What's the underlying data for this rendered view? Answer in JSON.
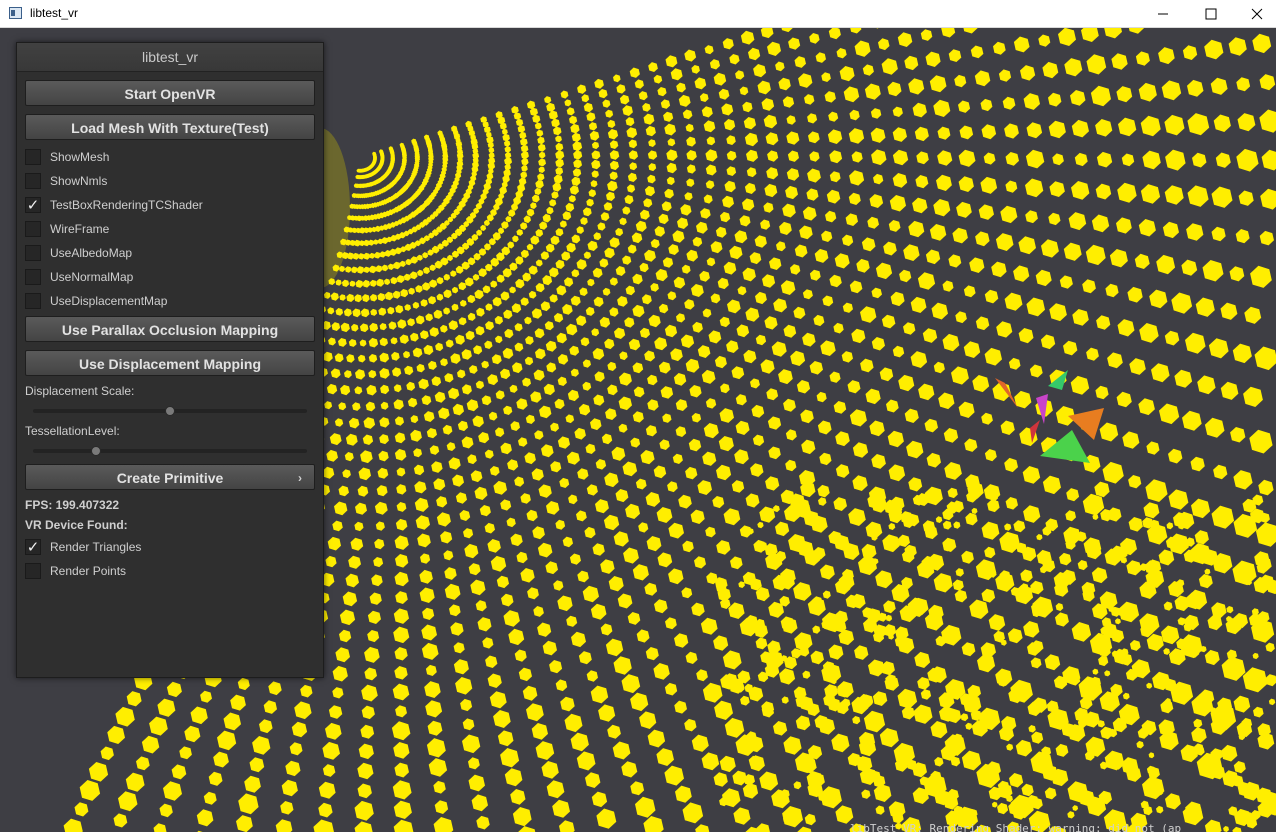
{
  "window": {
    "title": "libtest_vr",
    "minimize_label": "Minimize",
    "maximize_label": "Maximize",
    "close_label": "Close"
  },
  "panel": {
    "title": "libtest_vr",
    "buttons": {
      "start_openvr": "Start OpenVR",
      "load_mesh": "Load Mesh With Texture(Test)",
      "parallax": "Use Parallax Occlusion Mapping",
      "displacement": "Use Displacement Mapping",
      "create_primitive": "Create Primitive"
    },
    "create_primitive_arrow": "›",
    "checkboxes": [
      {
        "label": "ShowMesh",
        "checked": false
      },
      {
        "label": "ShowNmls",
        "checked": false
      },
      {
        "label": "TestBoxRenderingTCShader",
        "checked": true
      },
      {
        "label": "WireFrame",
        "checked": false
      },
      {
        "label": "UseAlbedoMap",
        "checked": false
      },
      {
        "label": "UseNormalMap",
        "checked": false
      },
      {
        "label": "UseDisplacementMap",
        "checked": false
      }
    ],
    "sliders": {
      "displacement_scale": {
        "label": "Displacement Scale:",
        "value": 0.5
      },
      "tessellation_level": {
        "label": "TessellationLevel:",
        "value": 0.22
      }
    },
    "fps": "FPS: 199.407322",
    "vr_device": "VR Device Found:",
    "render_checkboxes": [
      {
        "label": "Render Triangles",
        "checked": true
      },
      {
        "label": "Render Points",
        "checked": false
      }
    ]
  },
  "console_text": "libTest VR: Rendering Shader: warning: did not (ap",
  "colors": {
    "point_cloud": "#ffee00",
    "background": "#3e3e44",
    "panel": "#2f2f2f"
  },
  "check_glyph": "✓"
}
